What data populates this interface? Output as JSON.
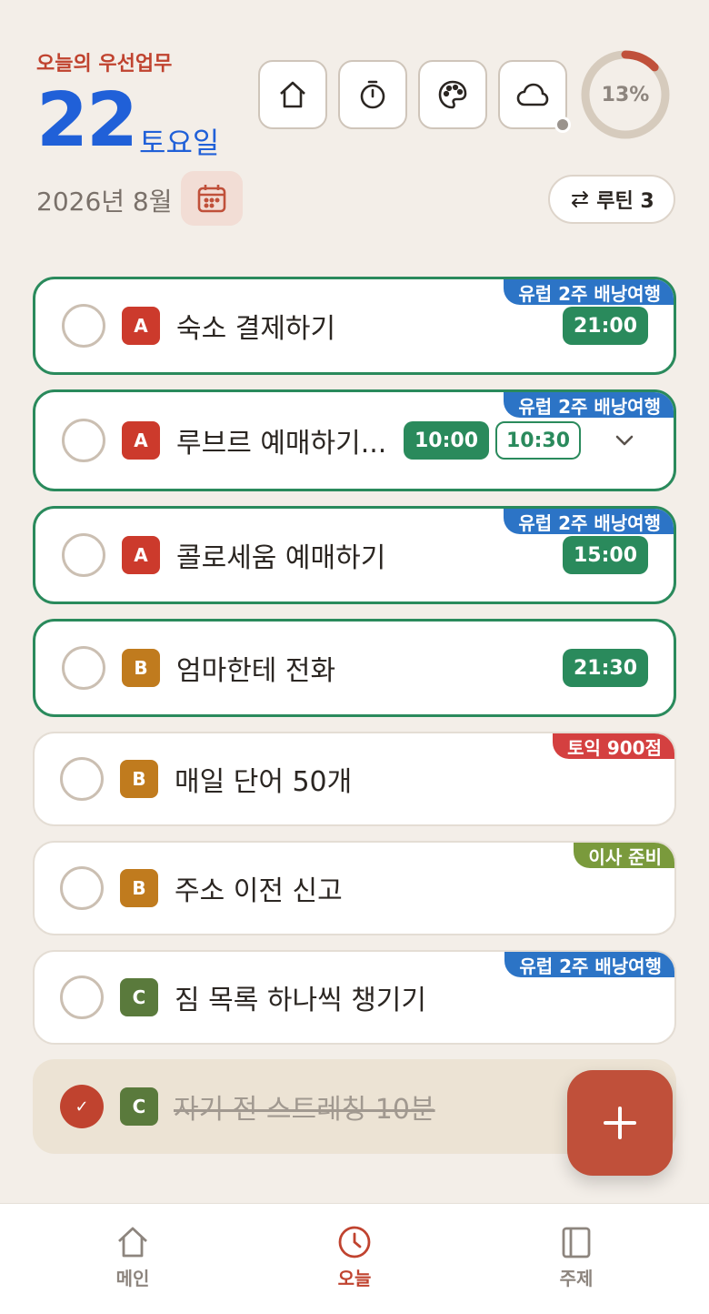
{
  "header": {
    "label": "오늘의 우선업무",
    "day": "22",
    "weekday": "토요일",
    "month": "2026년 8월"
  },
  "toolbar": {
    "icons": [
      "home-icon",
      "timer-icon",
      "palette-icon",
      "cloud-icon"
    ]
  },
  "progress": {
    "percent_label": "13%",
    "value": 0.13
  },
  "routine": {
    "label": "루틴 3"
  },
  "tasks": [
    {
      "priority": "A",
      "title": "숙소 결제하기",
      "times": [
        "21:00"
      ],
      "tag": "유럽 2주 배낭여행",
      "tag_color": "#2c74c6",
      "highlight": true,
      "done": false
    },
    {
      "priority": "A",
      "title": "루브르 예매하기...",
      "times": [
        "10:00",
        "10:30"
      ],
      "tag": "유럽 2주 배낭여행",
      "tag_color": "#2c74c6",
      "highlight": true,
      "done": false
    },
    {
      "priority": "A",
      "title": "콜로세움 예매하기",
      "times": [
        "15:00"
      ],
      "tag": "유럽 2주 배낭여행",
      "tag_color": "#2c74c6",
      "highlight": true,
      "done": false
    },
    {
      "priority": "B",
      "title": "엄마한테 전화",
      "times": [
        "21:30"
      ],
      "tag": "",
      "highlight": true,
      "done": false
    },
    {
      "priority": "B",
      "title": "매일 단어 50개",
      "times": [],
      "tag": "토익 900점",
      "tag_color": "#d44040",
      "highlight": false,
      "done": false
    },
    {
      "priority": "B",
      "title": "주소 이전 신고",
      "times": [],
      "tag": "이사 준비",
      "tag_color": "#7a9a3c",
      "highlight": false,
      "done": false
    },
    {
      "priority": "C",
      "title": "짐 목록 하나씩 챙기기",
      "times": [],
      "tag": "유럽 2주 배낭여행",
      "tag_color": "#2c74c6",
      "highlight": false,
      "done": false
    },
    {
      "priority": "C",
      "title": "자기 전 스트레칭 10분",
      "times": [],
      "tag": "",
      "highlight": false,
      "done": true,
      "check_mark": "✓"
    }
  ],
  "nav": {
    "items": [
      {
        "label": "메인",
        "icon": "home-icon"
      },
      {
        "label": "오늘",
        "icon": "clock-icon",
        "active": true
      },
      {
        "label": "주제",
        "icon": "book-icon"
      }
    ]
  },
  "colors": {
    "accent": "#c0432f",
    "date_blue": "#2060d8",
    "highlight_green": "#2a8a5c"
  }
}
